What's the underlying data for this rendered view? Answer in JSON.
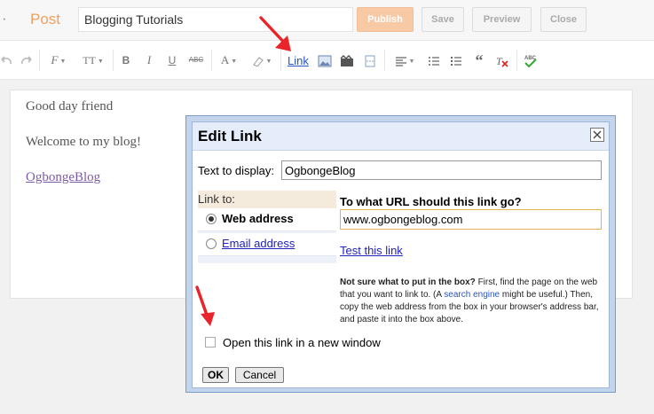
{
  "header": {
    "dots": "·",
    "post_label": "Post",
    "title_value": "Blogging Tutorials",
    "publish_label": "Publish",
    "save_label": "Save",
    "preview_label": "Preview",
    "close_label": "Close"
  },
  "toolbar": {
    "link_label": "Link",
    "font_label": "F",
    "size_label": "TT",
    "bold_label": "B",
    "italic_label": "I",
    "underline_label": "U",
    "strike_label": "ABC",
    "color_label": "A",
    "spell_label": "ABC"
  },
  "editor": {
    "line1": "Good day friend",
    "line2": "Welcome to my blog!",
    "link_text": "OgbongeBlog"
  },
  "dialog": {
    "title": "Edit Link",
    "text_to_display_label": "Text to display:",
    "text_to_display_value": "OgbongeBlog",
    "link_to_label": "Link to:",
    "web_address_label": "Web address",
    "email_address_label": "Email address",
    "url_question": "To what URL should this link go?",
    "url_value": "www.ogbongeblog.com",
    "test_link_label": "Test this link",
    "help_bold": "Not sure what to put in the box?",
    "help_text1": "First, find the page on the web that you want to link to. (A",
    "help_search_engine": "search engine",
    "help_text2": "might be useful.) Then, copy the web address from the box in your browser's address bar, and paste it into the box above.",
    "new_window_label": "Open this link in a new window",
    "ok_label": "OK",
    "cancel_label": "Cancel"
  },
  "colors": {
    "publish_bg": "#f8c9a5",
    "dialog_border": "#c3d5ec",
    "link_blue": "#2756c4",
    "arrow_red": "#e8232a"
  }
}
